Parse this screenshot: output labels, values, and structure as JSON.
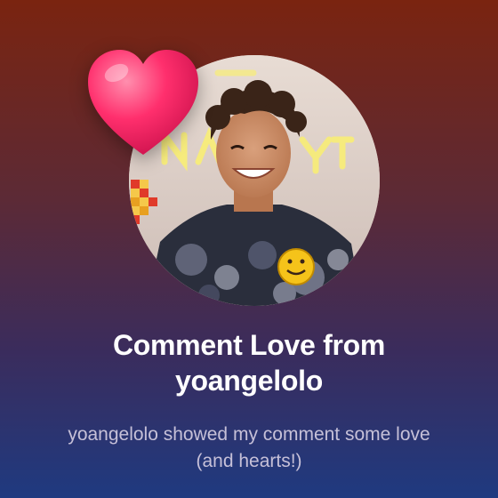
{
  "notification": {
    "title": "Comment Love from yoangelolo",
    "subtitle": "yoangelolo showed my comment some love (and hearts!)",
    "badge_icon": "heart-icon",
    "avatar_icon": "profile-photo",
    "colors": {
      "background_top": "#7a2410",
      "background_bottom": "#1f3a80",
      "heart": "#ff2f6d",
      "title": "#ffffff",
      "subtitle": "#c6c0d8"
    }
  }
}
